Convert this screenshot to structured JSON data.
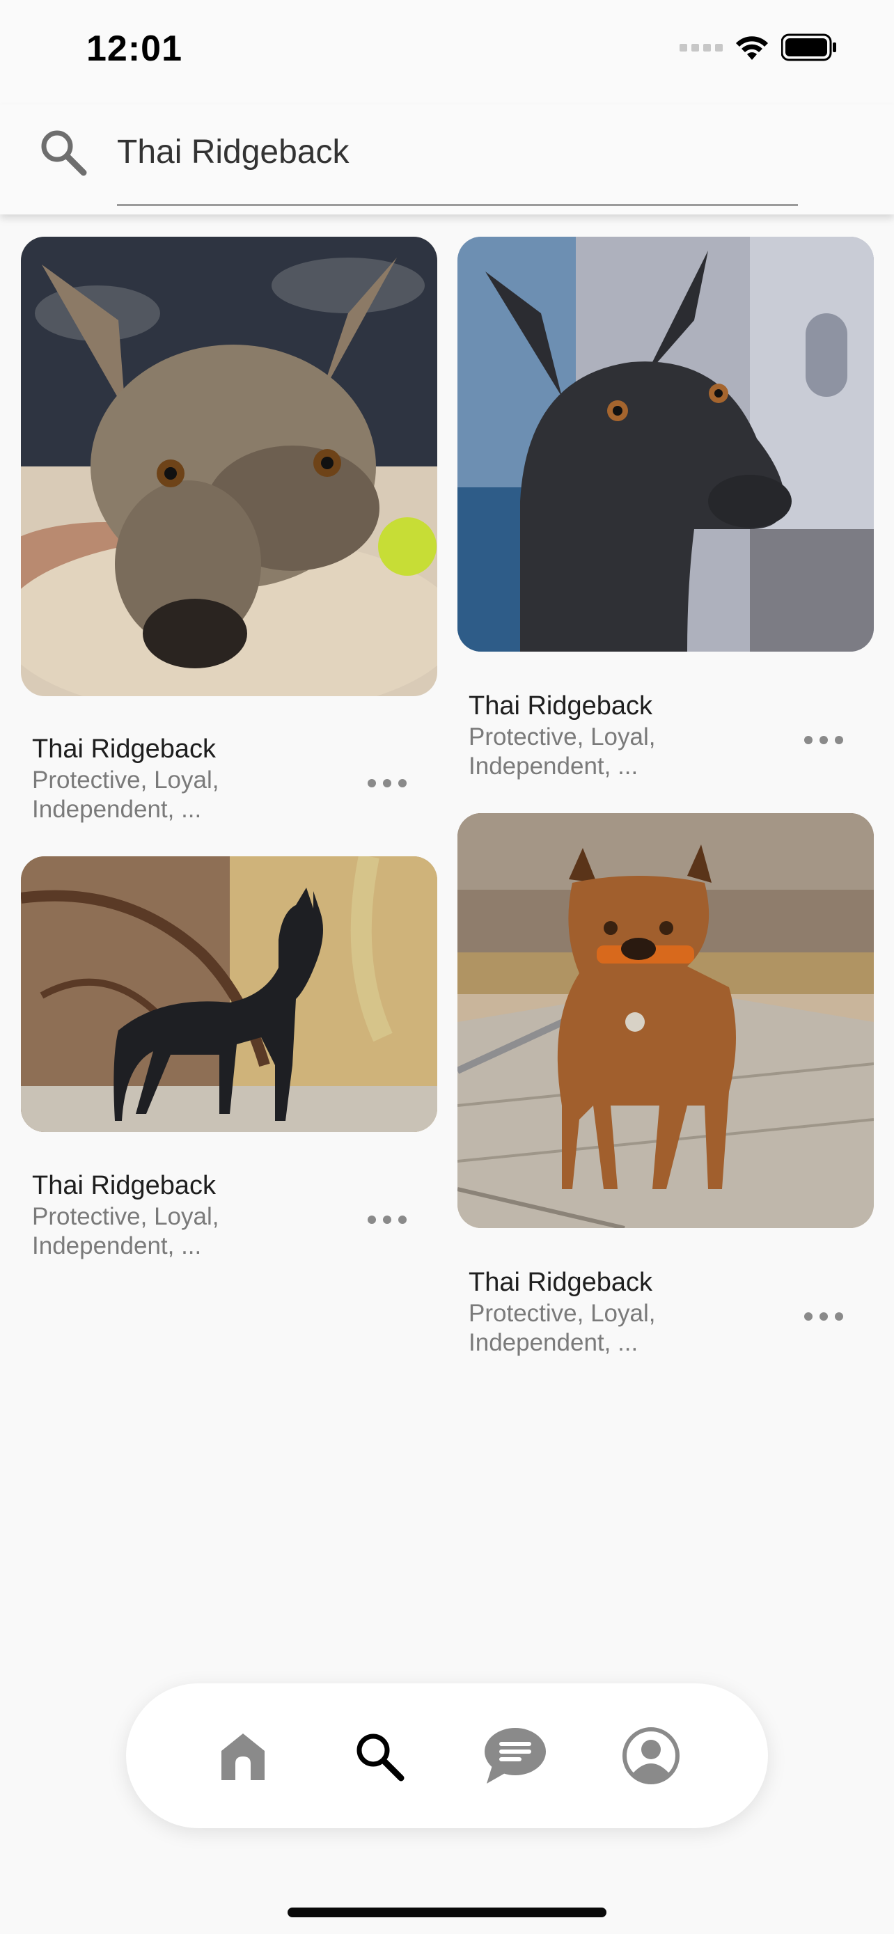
{
  "status_bar": {
    "time": "12:01"
  },
  "search": {
    "value": "Thai Ridgeback",
    "placeholder": ""
  },
  "results": [
    {
      "title": "Thai Ridgeback",
      "traits_line1": "Protective, Loyal,",
      "traits_line2": "Independent, ..."
    },
    {
      "title": "Thai Ridgeback",
      "traits_line1": "Protective, Loyal,",
      "traits_line2": "Independent, ..."
    },
    {
      "title": "Thai Ridgeback",
      "traits_line1": "Protective, Loyal,",
      "traits_line2": "Independent, ..."
    },
    {
      "title": "Thai Ridgeback",
      "traits_line1": "Protective, Loyal,",
      "traits_line2": "Independent, ..."
    }
  ],
  "tab_bar": {
    "tabs": [
      {
        "icon": "home-icon",
        "active": false
      },
      {
        "icon": "search-icon",
        "active": true
      },
      {
        "icon": "chat-icon",
        "active": false
      },
      {
        "icon": "profile-icon",
        "active": false
      }
    ],
    "active_color": "#000000",
    "inactive_color": "#8a8a8a"
  }
}
